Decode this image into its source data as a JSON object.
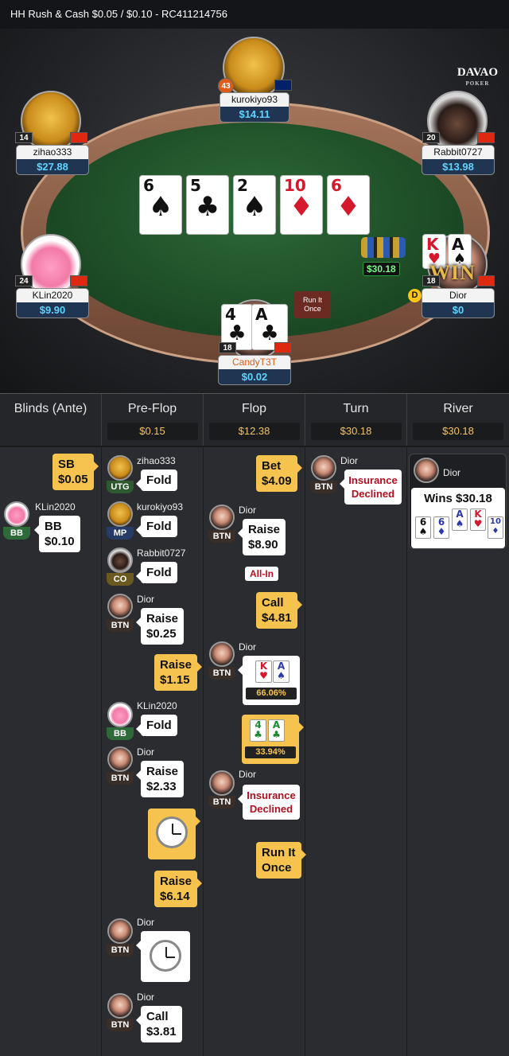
{
  "header": {
    "title": "HH  Rush & Cash $0.05 / $0.10   - RC411214756"
  },
  "logo": {
    "main": "DAVAO",
    "sub": "POKER"
  },
  "table": {
    "pot": "$30.18",
    "run_it_once": "Run It\nOnce",
    "dealer": "D",
    "win_text": "WIN",
    "board": [
      {
        "rank": "6",
        "suit": "♠",
        "color": "black"
      },
      {
        "rank": "5",
        "suit": "♣",
        "color": "black"
      },
      {
        "rank": "2",
        "suit": "♠",
        "color": "black"
      },
      {
        "rank": "10",
        "suit": "♦",
        "color": "red"
      },
      {
        "rank": "6",
        "suit": "♦",
        "color": "red"
      }
    ],
    "players": [
      {
        "name": "kurokiyo93",
        "stack": "$14.11",
        "level": "43",
        "flag": "uk"
      },
      {
        "name": "zihao333",
        "stack": "$27.88",
        "level": "14",
        "flag": "cn"
      },
      {
        "name": "Rabbit0727",
        "stack": "$13.98",
        "level": "20",
        "flag": "hk"
      },
      {
        "name": "KLin2020",
        "stack": "$9.90",
        "level": "24",
        "flag": "cn"
      },
      {
        "name": "Dior",
        "stack": "$0",
        "level": "18",
        "flag": "hk",
        "cards": [
          {
            "rank": "K",
            "suit": "♥"
          },
          {
            "rank": "A",
            "suit": "♠"
          }
        ]
      },
      {
        "name": "CandyT3T",
        "stack": "$0.02",
        "level": "18",
        "flag": "hk",
        "cards": [
          {
            "rank": "4",
            "suit": "♣"
          },
          {
            "rank": "A",
            "suit": "♣"
          }
        ]
      }
    ]
  },
  "streets": [
    {
      "label": "Blinds (Ante)",
      "pot": ""
    },
    {
      "label": "Pre-Flop",
      "pot": "$0.15"
    },
    {
      "label": "Flop",
      "pot": "$12.38"
    },
    {
      "label": "Turn",
      "pot": "$30.18"
    },
    {
      "label": "River",
      "pot": "$30.18"
    }
  ],
  "blinds": {
    "sb": {
      "label": "SB",
      "amount": "$0.05"
    },
    "bb": {
      "player": "KLin2020",
      "pos": "BB",
      "label": "BB",
      "amount": "$0.10"
    }
  },
  "preflop": [
    {
      "player": "zihao333",
      "pos": "UTG",
      "action": "Fold"
    },
    {
      "player": "kurokiyo93",
      "pos": "MP",
      "action": "Fold"
    },
    {
      "player": "Rabbit0727",
      "pos": "CO",
      "action": "Fold"
    },
    {
      "player": "Dior",
      "pos": "BTN",
      "action": "Raise",
      "amount": "$0.25"
    },
    {
      "action": "Raise",
      "amount": "$1.15"
    },
    {
      "player": "KLin2020",
      "pos": "BB",
      "action": "Fold"
    },
    {
      "player": "Dior",
      "pos": "BTN",
      "action": "Raise",
      "amount": "$2.33"
    },
    {
      "action": "Raise",
      "amount": "$6.14"
    },
    {
      "player": "Dior",
      "pos": "BTN"
    },
    {
      "player": "Dior",
      "pos": "BTN",
      "action": "Call",
      "amount": "$3.81"
    }
  ],
  "flop": {
    "bet": {
      "action": "Bet",
      "amount": "$4.09"
    },
    "raise": {
      "player": "Dior",
      "pos": "BTN",
      "action": "Raise",
      "amount": "$8.90",
      "allin": "All-In"
    },
    "call": {
      "action": "Call",
      "amount": "$4.81"
    },
    "show1": {
      "player": "Dior",
      "pos": "BTN",
      "cards": [
        {
          "rank": "K",
          "suit": "♥"
        },
        {
          "rank": "A",
          "suit": "♠"
        }
      ],
      "equity": "66.06%"
    },
    "show2": {
      "cards": [
        {
          "rank": "4",
          "suit": "♣"
        },
        {
          "rank": "A",
          "suit": "♣"
        }
      ],
      "equity": "33.94%"
    },
    "insurance": {
      "player": "Dior",
      "pos": "BTN",
      "text": "Insurance\nDeclined"
    },
    "runit": {
      "text": "Run It\nOnce"
    }
  },
  "turn": {
    "player": "Dior",
    "pos": "BTN",
    "text": "Insurance\nDeclined"
  },
  "river": {
    "player": "Dior",
    "wins": "Wins $30.18",
    "cards": [
      {
        "rank": "6",
        "suit": "♠"
      },
      {
        "rank": "6",
        "suit": "♦"
      },
      {
        "rank": "A",
        "suit": "♠"
      },
      {
        "rank": "K",
        "suit": "♥"
      },
      {
        "rank": "10",
        "suit": "♦"
      }
    ]
  }
}
